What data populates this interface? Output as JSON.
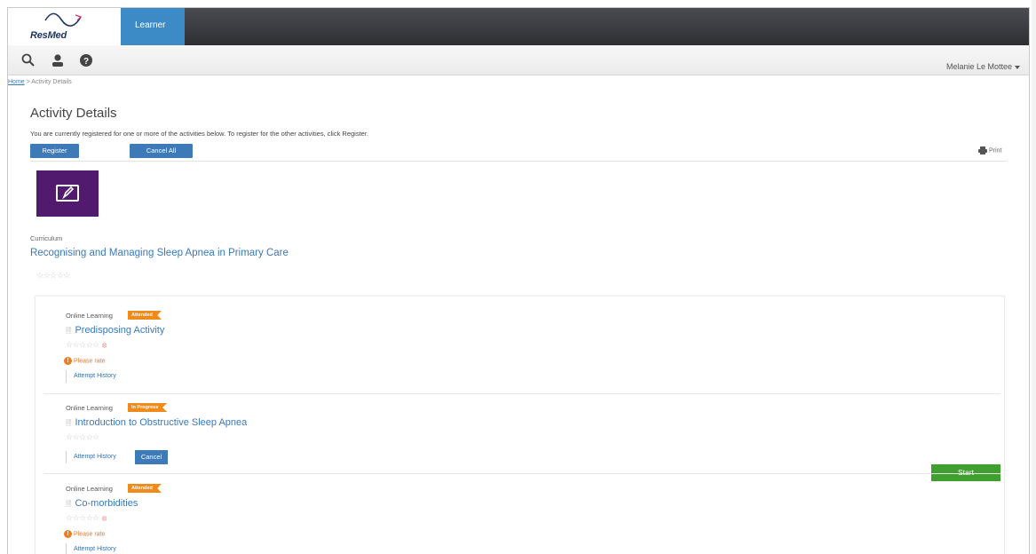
{
  "header": {
    "brand": "ResMed",
    "active_tab": "Learner",
    "user_name": "Melanie Le Mottee"
  },
  "icons": [
    "search-icon",
    "user-icon",
    "help-icon"
  ],
  "breadcrumb": {
    "home": "Home",
    "separator": " > ",
    "current": "Activity Details"
  },
  "page": {
    "title": "Activity Details",
    "intro": "You are currently registered for one or more of the activities below. To register for the other activities, click Register.",
    "register_label": "Register",
    "cancel_all_label": "Cancel All",
    "print_label": "Print"
  },
  "curriculum": {
    "type": "Curriculum",
    "title": "Recognising and Managing Sleep Apnea in Primary Care",
    "stars": "☆☆☆☆☆"
  },
  "activities": [
    {
      "type": "Online Learning",
      "status": "Attended",
      "title": "Predisposing Activity",
      "stars": "☆☆☆☆☆",
      "please_rate": "Please rate",
      "attempt_history": "Attempt History"
    },
    {
      "type": "Online Learning",
      "status": "In Progress",
      "title": "Introduction to Obstructive Sleep Apnea",
      "stars": "☆☆☆☆☆",
      "attempt_history": "Attempt History",
      "cancel_label": "Cancel",
      "start_label": "Start"
    },
    {
      "type": "Online Learning",
      "status": "Attended",
      "title": "Co-morbidities",
      "stars": "☆☆☆☆☆",
      "please_rate": "Please rate",
      "attempt_history": "Attempt History"
    }
  ],
  "colors": {
    "accent_blue": "#3f7ab8",
    "link_blue": "#3a78b8",
    "badge_orange": "#f08a1a",
    "start_green": "#3f9f2f",
    "thumb_purple": "#521a6f"
  }
}
